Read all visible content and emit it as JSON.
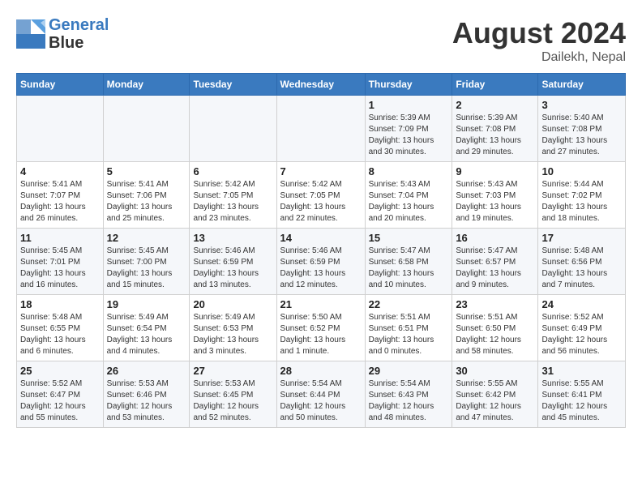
{
  "header": {
    "logo_line1": "General",
    "logo_line2": "Blue",
    "month_year": "August 2024",
    "location": "Dailekh, Nepal"
  },
  "weekdays": [
    "Sunday",
    "Monday",
    "Tuesday",
    "Wednesday",
    "Thursday",
    "Friday",
    "Saturday"
  ],
  "weeks": [
    [
      {
        "day": "",
        "info": ""
      },
      {
        "day": "",
        "info": ""
      },
      {
        "day": "",
        "info": ""
      },
      {
        "day": "",
        "info": ""
      },
      {
        "day": "1",
        "info": "Sunrise: 5:39 AM\nSunset: 7:09 PM\nDaylight: 13 hours\nand 30 minutes."
      },
      {
        "day": "2",
        "info": "Sunrise: 5:39 AM\nSunset: 7:08 PM\nDaylight: 13 hours\nand 29 minutes."
      },
      {
        "day": "3",
        "info": "Sunrise: 5:40 AM\nSunset: 7:08 PM\nDaylight: 13 hours\nand 27 minutes."
      }
    ],
    [
      {
        "day": "4",
        "info": "Sunrise: 5:41 AM\nSunset: 7:07 PM\nDaylight: 13 hours\nand 26 minutes."
      },
      {
        "day": "5",
        "info": "Sunrise: 5:41 AM\nSunset: 7:06 PM\nDaylight: 13 hours\nand 25 minutes."
      },
      {
        "day": "6",
        "info": "Sunrise: 5:42 AM\nSunset: 7:05 PM\nDaylight: 13 hours\nand 23 minutes."
      },
      {
        "day": "7",
        "info": "Sunrise: 5:42 AM\nSunset: 7:05 PM\nDaylight: 13 hours\nand 22 minutes."
      },
      {
        "day": "8",
        "info": "Sunrise: 5:43 AM\nSunset: 7:04 PM\nDaylight: 13 hours\nand 20 minutes."
      },
      {
        "day": "9",
        "info": "Sunrise: 5:43 AM\nSunset: 7:03 PM\nDaylight: 13 hours\nand 19 minutes."
      },
      {
        "day": "10",
        "info": "Sunrise: 5:44 AM\nSunset: 7:02 PM\nDaylight: 13 hours\nand 18 minutes."
      }
    ],
    [
      {
        "day": "11",
        "info": "Sunrise: 5:45 AM\nSunset: 7:01 PM\nDaylight: 13 hours\nand 16 minutes."
      },
      {
        "day": "12",
        "info": "Sunrise: 5:45 AM\nSunset: 7:00 PM\nDaylight: 13 hours\nand 15 minutes."
      },
      {
        "day": "13",
        "info": "Sunrise: 5:46 AM\nSunset: 6:59 PM\nDaylight: 13 hours\nand 13 minutes."
      },
      {
        "day": "14",
        "info": "Sunrise: 5:46 AM\nSunset: 6:59 PM\nDaylight: 13 hours\nand 12 minutes."
      },
      {
        "day": "15",
        "info": "Sunrise: 5:47 AM\nSunset: 6:58 PM\nDaylight: 13 hours\nand 10 minutes."
      },
      {
        "day": "16",
        "info": "Sunrise: 5:47 AM\nSunset: 6:57 PM\nDaylight: 13 hours\nand 9 minutes."
      },
      {
        "day": "17",
        "info": "Sunrise: 5:48 AM\nSunset: 6:56 PM\nDaylight: 13 hours\nand 7 minutes."
      }
    ],
    [
      {
        "day": "18",
        "info": "Sunrise: 5:48 AM\nSunset: 6:55 PM\nDaylight: 13 hours\nand 6 minutes."
      },
      {
        "day": "19",
        "info": "Sunrise: 5:49 AM\nSunset: 6:54 PM\nDaylight: 13 hours\nand 4 minutes."
      },
      {
        "day": "20",
        "info": "Sunrise: 5:49 AM\nSunset: 6:53 PM\nDaylight: 13 hours\nand 3 minutes."
      },
      {
        "day": "21",
        "info": "Sunrise: 5:50 AM\nSunset: 6:52 PM\nDaylight: 13 hours\nand 1 minute."
      },
      {
        "day": "22",
        "info": "Sunrise: 5:51 AM\nSunset: 6:51 PM\nDaylight: 13 hours\nand 0 minutes."
      },
      {
        "day": "23",
        "info": "Sunrise: 5:51 AM\nSunset: 6:50 PM\nDaylight: 12 hours\nand 58 minutes."
      },
      {
        "day": "24",
        "info": "Sunrise: 5:52 AM\nSunset: 6:49 PM\nDaylight: 12 hours\nand 56 minutes."
      }
    ],
    [
      {
        "day": "25",
        "info": "Sunrise: 5:52 AM\nSunset: 6:47 PM\nDaylight: 12 hours\nand 55 minutes."
      },
      {
        "day": "26",
        "info": "Sunrise: 5:53 AM\nSunset: 6:46 PM\nDaylight: 12 hours\nand 53 minutes."
      },
      {
        "day": "27",
        "info": "Sunrise: 5:53 AM\nSunset: 6:45 PM\nDaylight: 12 hours\nand 52 minutes."
      },
      {
        "day": "28",
        "info": "Sunrise: 5:54 AM\nSunset: 6:44 PM\nDaylight: 12 hours\nand 50 minutes."
      },
      {
        "day": "29",
        "info": "Sunrise: 5:54 AM\nSunset: 6:43 PM\nDaylight: 12 hours\nand 48 minutes."
      },
      {
        "day": "30",
        "info": "Sunrise: 5:55 AM\nSunset: 6:42 PM\nDaylight: 12 hours\nand 47 minutes."
      },
      {
        "day": "31",
        "info": "Sunrise: 5:55 AM\nSunset: 6:41 PM\nDaylight: 12 hours\nand 45 minutes."
      }
    ]
  ]
}
